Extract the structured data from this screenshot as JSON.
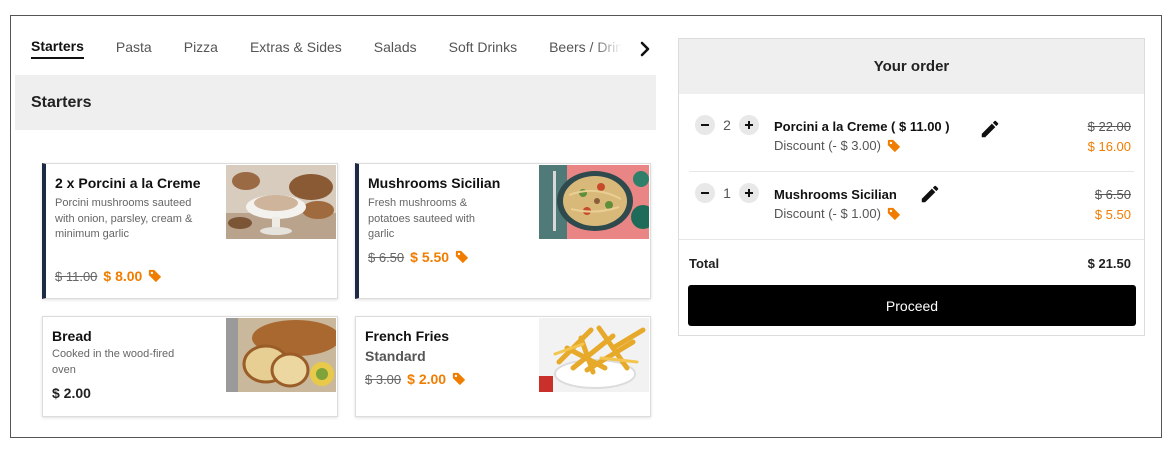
{
  "menu": {
    "tabs": [
      {
        "label": "Starters",
        "active": true
      },
      {
        "label": "Pasta"
      },
      {
        "label": "Pizza"
      },
      {
        "label": "Extras & Sides"
      },
      {
        "label": "Salads"
      },
      {
        "label": "Soft Drinks"
      },
      {
        "label": "Beers / Drinks"
      }
    ],
    "section_title": "Starters",
    "items": [
      {
        "title": "2 x  Porcini a la Creme",
        "description": "Porcini mushrooms sauteed with onion, parsley, cream & minimum garlic",
        "old_price": "$ 11.00",
        "price": "$ 8.00",
        "discounted": true,
        "in_order": true
      },
      {
        "title": "Mushrooms Sicilian",
        "description": "Fresh mushrooms & potatoes sauteed with garlic",
        "old_price": "$ 6.50",
        "price": "$ 5.50",
        "discounted": true,
        "in_order": true
      },
      {
        "title": "Bread",
        "description": "Cooked in the wood-fired oven",
        "price": "$ 2.00",
        "discounted": false
      },
      {
        "title": "French Fries",
        "subtitle": "Standard",
        "old_price": "$ 3.00",
        "price": "$ 2.00",
        "discounted": true
      }
    ]
  },
  "order": {
    "title": "Your order",
    "items": [
      {
        "qty": "2",
        "name": "Porcini a la Creme ( $ 11.00 )",
        "discount": "Discount (- $ 3.00)",
        "old_total": "$ 22.00",
        "total": "$ 16.00"
      },
      {
        "qty": "1",
        "name": "Mushrooms Sicilian",
        "discount": "Discount (- $ 1.00)",
        "old_total": "$ 6.50",
        "total": "$ 5.50"
      }
    ],
    "total_label": "Total",
    "total_value": "$ 21.50",
    "proceed_label": "Proceed"
  },
  "colors": {
    "accent": "#f07d00",
    "dark": "#1c2a44",
    "button": "#000000",
    "section_bg": "#efefef"
  },
  "icons": [
    "chevron-right-icon",
    "price-tag-icon",
    "minus-icon",
    "plus-icon",
    "pencil-icon"
  ]
}
